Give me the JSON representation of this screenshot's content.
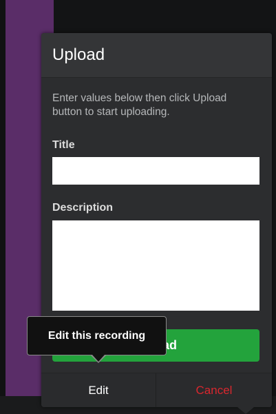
{
  "dialog": {
    "title": "Upload",
    "instructions": "Enter values below then click Upload button to start uploading.",
    "title_label": "Title",
    "title_value": "",
    "description_label": "Description",
    "description_value": "",
    "upload_label": "Upload"
  },
  "footer": {
    "edit_label": "Edit",
    "cancel_label": "Cancel"
  },
  "tooltip": {
    "text": "Edit this recording"
  },
  "colors": {
    "accent_purple": "#5a2d68",
    "upload_green": "#23a33c",
    "cancel_red": "#d9272e",
    "panel_bg": "#2c2d2f"
  }
}
